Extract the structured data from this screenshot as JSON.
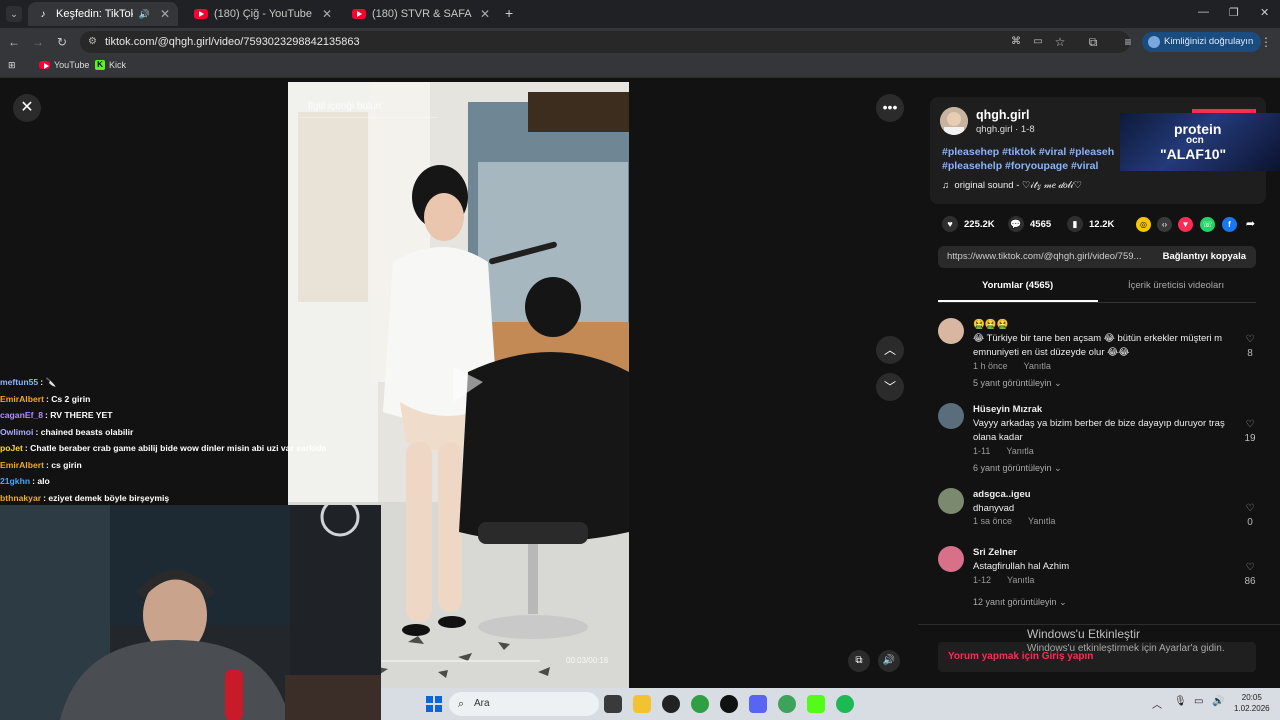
{
  "browser": {
    "tabs": [
      {
        "title": "Keşfedin: TikTok'ta favori vi",
        "active": true
      },
      {
        "title": "(180) Çiğ - YouTube",
        "active": false
      },
      {
        "title": "(180) STVR & SAFA - Denk Değ",
        "active": false
      }
    ],
    "url": "tiktok.com/@qhgh.girl/video/7593023298842135863",
    "verify_label": "Kimliğinizi doğrulayın",
    "bookmarks": [
      "YouTube",
      "Kick"
    ]
  },
  "video": {
    "search_placeholder": "İlgili içeriği bulun",
    "time": "00:03/00:16"
  },
  "profile": {
    "username": "qhgh.girl",
    "subline": "qhgh.girl · 1-8",
    "hashtags_line1": "#pleasehep #tiktok #viral #pleaseh",
    "hashtags_line2": "#pleasehelp #foryoupage #viral",
    "sound": "original sound - ♡𝒾𝓉𝓏  𝓂𝑒  𝒹𝑜𝓁𝒾♡"
  },
  "ad": {
    "line1": "protein",
    "line2": "ocn",
    "code": "\"ALAF10\""
  },
  "stats": {
    "likes": "225.2K",
    "comments": "4565",
    "saves": "12.2K"
  },
  "copy": {
    "url": "https://www.tiktok.com/@qhgh.girl/video/759...",
    "button": "Bağlantıyı kopyala"
  },
  "comment_tabs": {
    "comments": "Yorumlar (4565)",
    "creator": "İçerik üreticisi videoları"
  },
  "comments": [
    {
      "name": "🤮🤮🤮",
      "text": "😂 Türkiye bir tane ben açsam 😂 bütün erkekler müşteri m emnuniyeti en üst düzeyde olur 😂😂",
      "time": "1 h önce",
      "reply": "Yanıtla",
      "replies": "5 yanıt görüntüleyin",
      "likes": "8"
    },
    {
      "name": "Hüseyin Mızrak",
      "text": "Vayyy arkadaş ya bizim berber de bize dayayıp duruyor traş olana kadar",
      "time": "1-11",
      "reply": "Yanıtla",
      "replies": "6 yanıt görüntüleyin",
      "likes": "19"
    },
    {
      "name": "adsgca..igeu",
      "text": "dhanyvad",
      "time": "1 sa önce",
      "reply": "Yanıtla",
      "replies": "",
      "likes": "0"
    },
    {
      "name": "Sri Zelner",
      "text": "Astagfirullah hal Azhim",
      "time": "1-12",
      "reply": "Yanıtla",
      "replies": "12 yanıt görüntüleyin",
      "likes": "86"
    }
  ],
  "login_prompt": "Yorum yapmak için Giriş yapın",
  "windows_activation": {
    "title": "Windows'u Etkinleştir",
    "subtitle": "Windows'u etkinleştirmek için Ayarlar'a gidin."
  },
  "chat": [
    {
      "user": "meftun55",
      "color": "#8ab4f8",
      "msg": "🔪"
    },
    {
      "user": "EmirAlbert",
      "color": "#f5a623",
      "msg": "Cs 2 girin"
    },
    {
      "user": "caganEf_8",
      "color": "#b18cff",
      "msg": "RV THERE YET"
    },
    {
      "user": "Owlimoi",
      "color": "#a9a9ff",
      "msg": "chained beasts olabilir"
    },
    {
      "user": "poJet",
      "color": "#ffd24a",
      "msg": "Chatle beraber crab game abilij bide wow dinler misin abi uzi var sarkida"
    },
    {
      "user": "EmirAlbert",
      "color": "#f5a623",
      "msg": "cs girin"
    },
    {
      "user": "21gkhn",
      "color": "#4aa3ff",
      "msg": "alo"
    },
    {
      "user": "bthnakyar",
      "color": "#f5a623",
      "msg": "eziyet demek böyle birşeymiş"
    }
  ],
  "taskbar": {
    "search": "Ara",
    "time": "20:05",
    "date": "1.02.2026"
  }
}
